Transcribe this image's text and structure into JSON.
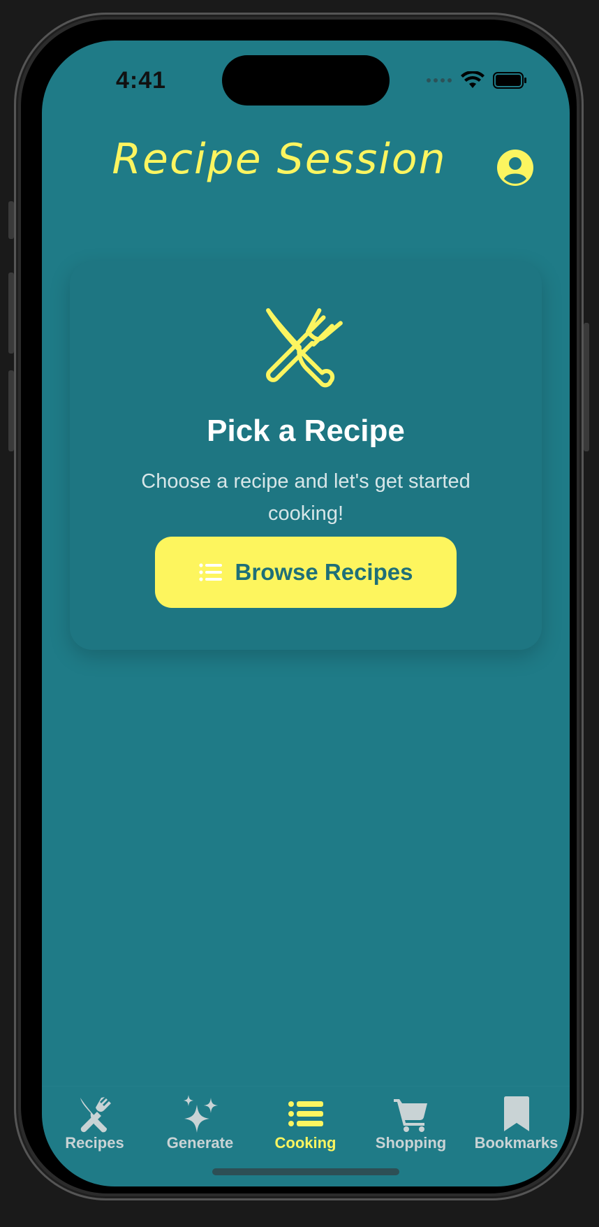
{
  "status_bar": {
    "time": "4:41",
    "icons": [
      "signal-dots-icon",
      "wifi-icon",
      "battery-icon"
    ]
  },
  "header": {
    "title": "Recipe Session",
    "profile_icon": "person-circle-icon"
  },
  "empty_state": {
    "icon": "fork-knife-icon",
    "title": "Pick a Recipe",
    "subtitle": "Choose a recipe and let's get started cooking!",
    "button_icon": "list-icon",
    "button_label": "Browse Recipes"
  },
  "tabbar": {
    "tabs": [
      {
        "label": "Recipes",
        "icon": "fork-knife-icon",
        "active": false
      },
      {
        "label": "Generate",
        "icon": "sparkles-icon",
        "active": false
      },
      {
        "label": "Cooking",
        "icon": "list-icon",
        "active": true
      },
      {
        "label": "Shopping",
        "icon": "cart-icon",
        "active": false
      },
      {
        "label": "Bookmarks",
        "icon": "bookmark-icon",
        "active": false
      }
    ]
  },
  "colors": {
    "background": "#1f7b87",
    "accent": "#fcf560",
    "button_text": "#1f6f78",
    "inactive_tab": "#c9d3d5"
  }
}
